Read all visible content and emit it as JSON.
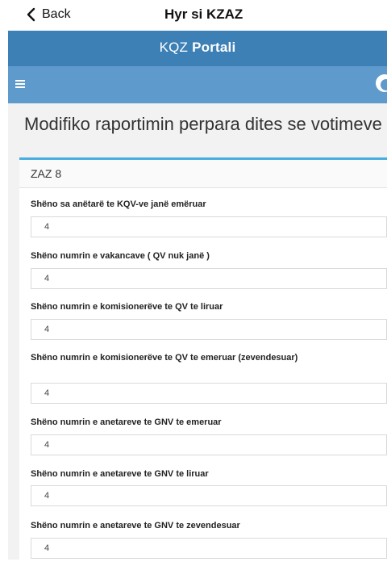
{
  "nav": {
    "back_label": "Back",
    "title": "Hyr si KZAZ"
  },
  "portal": {
    "title_prefix": "KQZ",
    "title_bold": "Portali"
  },
  "page": {
    "title": "Modifiko raportimin perpara dites se votimeve"
  },
  "card": {
    "header": "ZAZ 8"
  },
  "fields": [
    {
      "label": "Shëno sa anëtarë te KQV-ve janë emëruar",
      "value": "4"
    },
    {
      "label": "Shëno numrin e vakancave ( QV nuk janë )",
      "value": "4"
    },
    {
      "label": "Shëno numrin e komisionerëve te QV te liruar",
      "value": "4"
    },
    {
      "label": "Shëno numrin e komisionerëve te QV te emeruar (zevendesuar)",
      "value": "4"
    },
    {
      "label": "Shëno numrin e anetareve te GNV te emeruar",
      "value": "4"
    },
    {
      "label": "Shëno numrin e anetareve te GNV te liruar",
      "value": "4"
    },
    {
      "label": "Shëno numrin e anetareve te GNV te zevendesuar",
      "value": "4"
    }
  ],
  "icons": {
    "back": "chevron-left-icon",
    "menu": "hamburger-icon",
    "user": "user-icon"
  },
  "colors": {
    "header": "#3d80b6",
    "menu_bar": "#5f9acd",
    "card_accent": "#48aee0"
  }
}
